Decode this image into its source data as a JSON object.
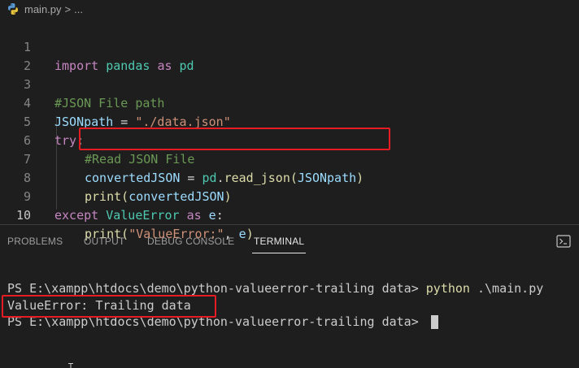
{
  "breadcrumb": {
    "file": "main.py",
    "separator": ">",
    "ellipsis": "..."
  },
  "editor": {
    "line_numbers": [
      "1",
      "2",
      "3",
      "4",
      "5",
      "6",
      "7",
      "8",
      "9",
      "10"
    ],
    "line1": {
      "kw": "import",
      "mod": "pandas",
      "as": "as",
      "alias": "pd"
    },
    "line3": {
      "comment": "#JSON File path"
    },
    "line4": {
      "var": "JSONpath",
      "eq": " = ",
      "str": "\"./data.json\""
    },
    "line5": {
      "kw": "try",
      "colon": ":"
    },
    "line6": {
      "comment": "#Read JSON File"
    },
    "line7": {
      "var": "convertedJSON",
      "eq": " = ",
      "mod": "pd",
      "dot": ".",
      "fn": "read_json",
      "open": "(",
      "arg": "JSONpath",
      "close": ")"
    },
    "line8": {
      "fn": "print",
      "open": "(",
      "arg": "convertedJSON",
      "close": ")"
    },
    "line9": {
      "kw": "except",
      "cls": "ValueError",
      "as": "as",
      "var": "e",
      "colon": ":"
    },
    "line10": {
      "fn": "print",
      "open": "(",
      "str": "\"ValueError:\"",
      "comma": ", ",
      "var": "e",
      "close": ")"
    }
  },
  "panel": {
    "tabs": [
      {
        "label": "PROBLEMS"
      },
      {
        "label": "OUTPUT"
      },
      {
        "label": "DEBUG CONSOLE"
      },
      {
        "label": "TERMINAL"
      }
    ]
  },
  "terminal": {
    "line1_prompt": "PS E:\\xampp\\htdocs\\demo\\python-valueerror-trailing data> ",
    "line1_cmd": "python",
    "line1_args": " .\\main.py",
    "line2": "ValueError: Trailing data",
    "line3_prompt": "PS E:\\xampp\\htdocs\\demo\\python-valueerror-trailing data> "
  },
  "colors": {
    "highlight_box": "#e51c23",
    "background": "#1e1e1e"
  }
}
